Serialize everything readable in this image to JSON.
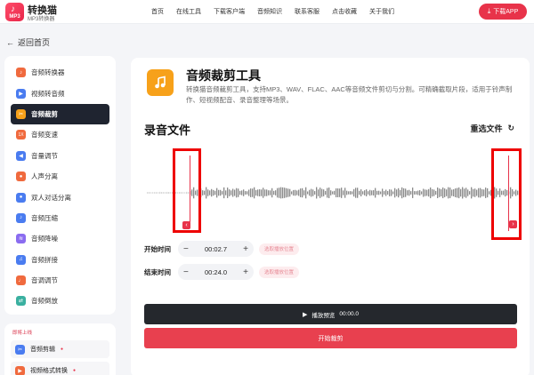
{
  "header": {
    "logo_text": "MP3",
    "brand_name": "转换猫",
    "brand_sub": "MP3转换器",
    "nav": [
      "首页",
      "在线工具",
      "下载客户端",
      "音频知识",
      "联系客服",
      "点击收藏",
      "关于我们"
    ],
    "download_label": "下载APP"
  },
  "back_label": "返回首页",
  "sidebar": {
    "items": [
      {
        "label": "音频转换器",
        "color": "#f06a3e"
      },
      {
        "label": "视频转音频",
        "color": "#4a7cf0"
      },
      {
        "label": "音频裁剪",
        "color": "#f7a11a",
        "active": true
      },
      {
        "label": "音频变速",
        "color": "#f06a3e",
        "icon_text": "1X"
      },
      {
        "label": "音量调节",
        "color": "#4a7cf0"
      },
      {
        "label": "人声分离",
        "color": "#f06a3e"
      },
      {
        "label": "双人对话分离",
        "color": "#4a7cf0"
      },
      {
        "label": "音频压缩",
        "color": "#4a7cf0"
      },
      {
        "label": "音频降噪",
        "color": "#8a6cf0"
      },
      {
        "label": "音频拼接",
        "color": "#4a7cf0"
      },
      {
        "label": "音调调节",
        "color": "#f06a3e"
      },
      {
        "label": "音频倒放",
        "color": "#3ab0a0"
      }
    ],
    "section2_label": "即将上线",
    "section2_items": [
      {
        "label": "音频剪辑",
        "tag": "●"
      },
      {
        "label": "视频格式转换",
        "tag": "●"
      }
    ]
  },
  "main": {
    "title": "音频裁剪工具",
    "description": "转换猫音频裁剪工具，支持MP3、WAV、FLAC、AAC等音频文件剪切与分割。可精确截取片段，适用于铃声制作、短视频配音、录音整理等场景。",
    "section_title": "录音文件",
    "reselect_label": "重选文件",
    "start_label": "开始时间",
    "start_value": "00:02.7",
    "end_label": "结束时间",
    "end_value": "00:24.0",
    "pick_label": "选取播放位置",
    "preview_label": "播放预览",
    "preview_time": "00:00.0",
    "cut_label": "开始裁剪"
  },
  "colors": {
    "accent": "#e8334a",
    "dark": "#25282d",
    "tool_icon": "#f7a11a"
  }
}
